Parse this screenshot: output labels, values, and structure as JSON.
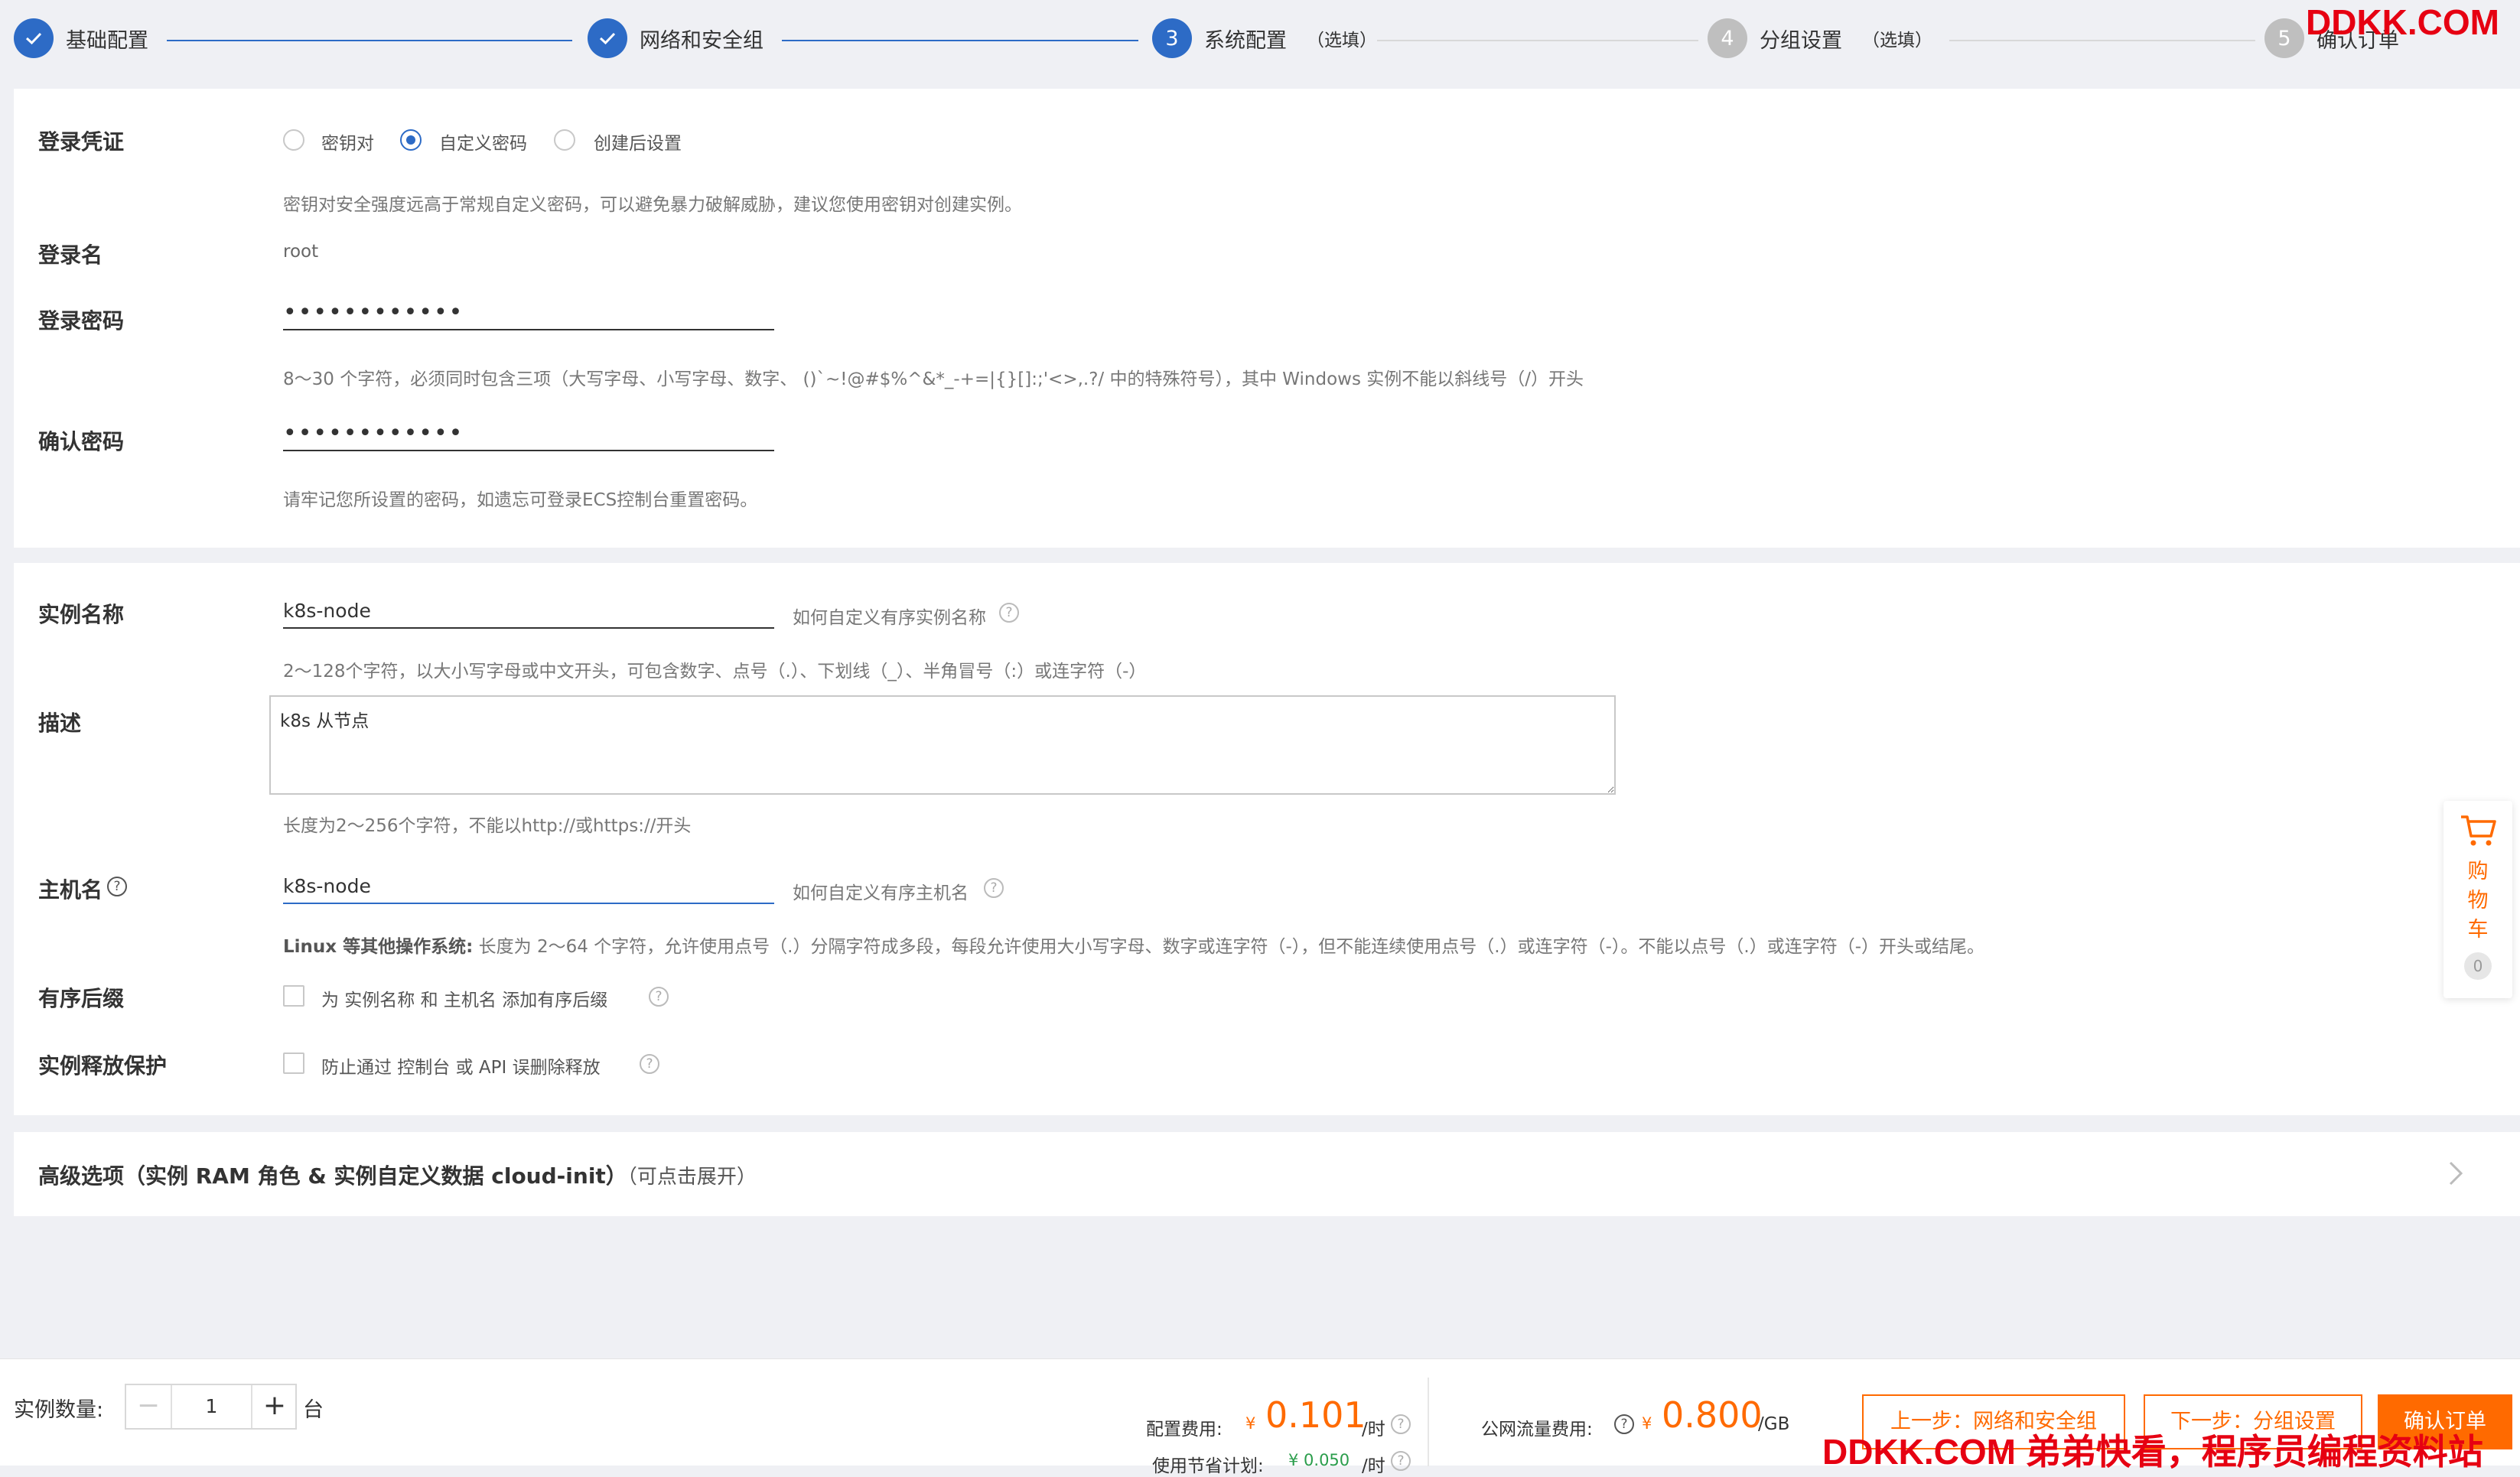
{
  "steps": [
    {
      "num": "",
      "label": "基础配置",
      "optional": "",
      "state": "done"
    },
    {
      "num": "",
      "label": "网络和安全组",
      "optional": "",
      "state": "done"
    },
    {
      "num": "3",
      "label": "系统配置",
      "optional": "（选填）",
      "state": "active"
    },
    {
      "num": "4",
      "label": "分组设置",
      "optional": "（选填）",
      "state": "todo"
    },
    {
      "num": "5",
      "label": "确认订单",
      "optional": "",
      "state": "todo"
    }
  ],
  "login": {
    "credential_label": "登录凭证",
    "options": [
      "密钥对",
      "自定义密码",
      "创建后设置"
    ],
    "selected": "自定义密码",
    "credential_hint": "密钥对安全强度远高于常规自定义密码，可以避免暴力破解威胁，建议您使用密钥对创建实例。",
    "username_label": "登录名",
    "username_value": "root",
    "password_label": "登录密码",
    "password_value": "••••••••••••",
    "password_hint": "8～30 个字符，必须同时包含三项（大写字母、小写字母、数字、 ()`~!@#$%^&*_-+=|{}[]:;'<>,.?/ 中的特殊符号），其中 Windows 实例不能以斜线号（/）开头",
    "confirm_label": "确认密码",
    "confirm_value": "••••••••••••",
    "confirm_hint": "请牢记您所设置的密码，如遗忘可登录ECS控制台重置密码。"
  },
  "instance": {
    "name_label": "实例名称",
    "name_value": "k8s-node",
    "name_help": "如何自定义有序实例名称",
    "name_hint": "2～128个字符，以大小写字母或中文开头，可包含数字、点号（.）、下划线（_）、半角冒号（:）或连字符（-）",
    "desc_label": "描述",
    "desc_value": "k8s 从节点",
    "desc_hint": "长度为2～256个字符，不能以http://或https://开头",
    "host_label": "主机名",
    "host_value": "k8s-node",
    "host_help": "如何自定义有序主机名",
    "host_hint_bold": "Linux 等其他操作系统:",
    "host_hint": "长度为 2～64 个字符，允许使用点号（.）分隔字符成多段，每段允许使用大小写字母、数字或连字符（-），但不能连续使用点号（.）或连字符（-）。不能以点号（.）或连字符（-）开头或结尾。",
    "suffix_label": "有序后缀",
    "suffix_text": "为 实例名称 和 主机名 添加有序后缀",
    "protect_label": "实例释放保护",
    "protect_text": "防止通过 控制台 或 API 误删除释放"
  },
  "advanced": {
    "title": "高级选项（实例 RAM 角色 & 实例自定义数据 cloud-init）",
    "expand_hint": "（可点击展开）"
  },
  "cart": {
    "label": "购物车",
    "count": "0"
  },
  "footer": {
    "count_label": "实例数量:",
    "count_value": "1",
    "unit": "台",
    "config_fee_label": "配置费用:",
    "config_fee_currency": "¥",
    "config_fee_value": "0.101",
    "config_fee_unit": "/时",
    "saving_label": "使用节省计划:",
    "saving_value": "¥ 0.050",
    "saving_unit": "/时",
    "traffic_fee_label": "公网流量费用:",
    "traffic_fee_currency": "¥",
    "traffic_fee_value": "0.800",
    "traffic_fee_unit": "/GB",
    "prev_button": "上一步：网络和安全组",
    "next_button": "下一步：分组设置",
    "confirm_button": "确认订单"
  },
  "watermark": {
    "top": "DDKK.COM",
    "bottom": "DDKK.COM 弟弟快看，程序员编程资料站"
  },
  "colors": {
    "primary": "#2d6bc6",
    "accent": "#ff6a00",
    "watermark": "#e60012"
  }
}
